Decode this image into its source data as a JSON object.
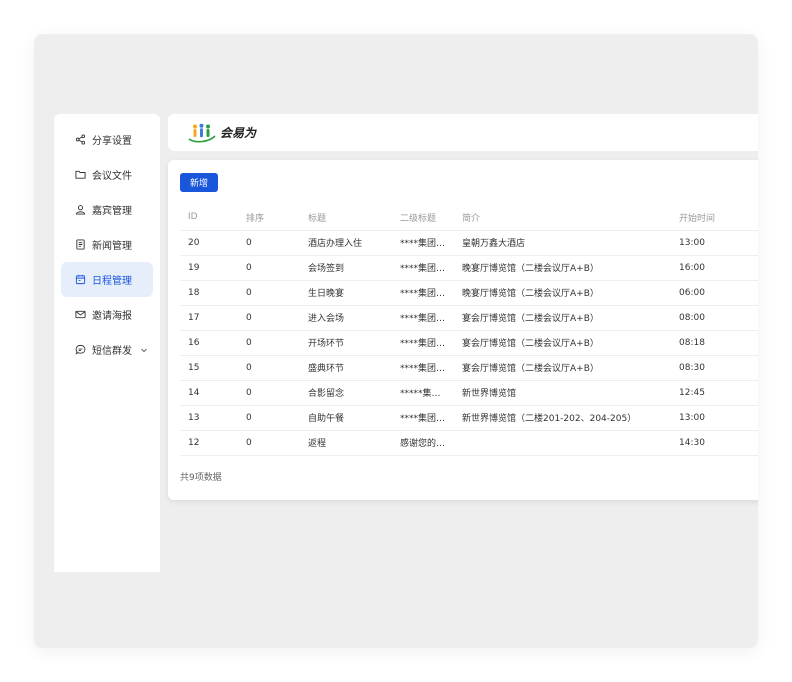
{
  "brand": {
    "name": "会易为"
  },
  "sidebar": {
    "items": [
      {
        "label": "分享设置",
        "icon": "share-icon"
      },
      {
        "label": "会议文件",
        "icon": "folder-icon"
      },
      {
        "label": "嘉宾管理",
        "icon": "user-icon"
      },
      {
        "label": "新闻管理",
        "icon": "document-icon"
      },
      {
        "label": "日程管理",
        "icon": "calendar-icon",
        "active": true
      },
      {
        "label": "邀请海报",
        "icon": "mail-icon"
      },
      {
        "label": "短信群发",
        "icon": "message-icon",
        "expandable": true
      }
    ]
  },
  "toolbar": {
    "add_label": "新增"
  },
  "table": {
    "columns": [
      "ID",
      "排序",
      "标题",
      "二级标题",
      "简介",
      "开始时间"
    ],
    "rows": [
      [
        "20",
        "0",
        "酒店办理入住",
        "****集团…",
        "皇朝万鑫大酒店",
        "13:00"
      ],
      [
        "19",
        "0",
        "会场签到",
        "****集团…",
        "晚宴厅博览馆（二楼会议厅A+B）",
        "16:00"
      ],
      [
        "18",
        "0",
        "生日晚宴",
        "****集团…",
        "晚宴厅博览馆（二楼会议厅A+B）",
        "06:00"
      ],
      [
        "17",
        "0",
        "进入会场",
        "****集团…",
        "宴会厅博览馆（二楼会议厅A+B）",
        "08:00"
      ],
      [
        "16",
        "0",
        "开场环节",
        "****集团…",
        "宴会厅博览馆（二楼会议厅A+B）",
        "08:18"
      ],
      [
        "15",
        "0",
        "盛典环节",
        "****集团…",
        "宴会厅博览馆（二楼会议厅A+B）",
        "08:30"
      ],
      [
        "14",
        "0",
        "合影留念",
        "*****集…",
        "新世界博览馆",
        "12:45"
      ],
      [
        "13",
        "0",
        "自助午餐",
        "****集团…",
        "新世界博览馆（二楼201-202、204-205）",
        "13:00"
      ],
      [
        "12",
        "0",
        "返程",
        "感谢您的…",
        "",
        "14:30"
      ]
    ]
  },
  "footer": {
    "total_text": "共9项数据"
  },
  "colors": {
    "accent": "#1a56db",
    "active_bg": "#e6eefc",
    "frame_bg": "#eeeeee"
  }
}
